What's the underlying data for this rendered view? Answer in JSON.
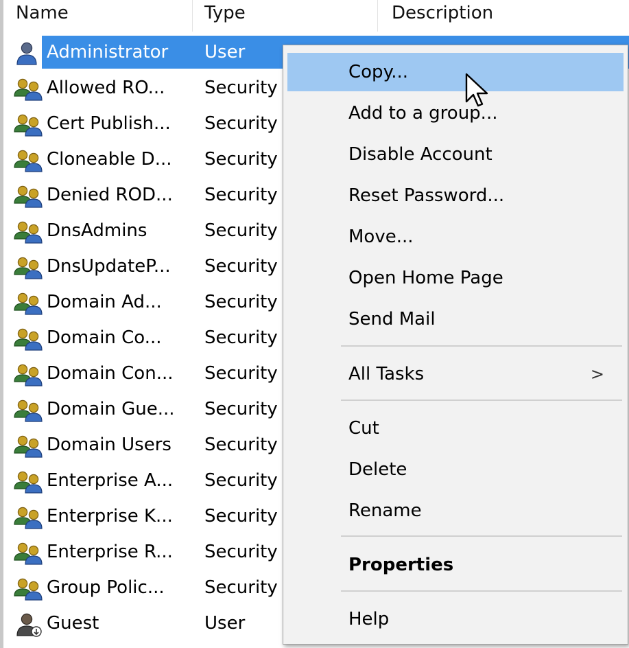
{
  "columns": {
    "name": "Name",
    "type": "Type",
    "description": "Description"
  },
  "rows": [
    {
      "name": "Administrator",
      "type": "User",
      "icon": "user-icon"
    },
    {
      "name": "Allowed RO...",
      "type": "Security",
      "icon": "group-icon"
    },
    {
      "name": "Cert Publish...",
      "type": "Security",
      "icon": "group-icon"
    },
    {
      "name": "Cloneable D...",
      "type": "Security",
      "icon": "group-icon"
    },
    {
      "name": "Denied ROD...",
      "type": "Security",
      "icon": "group-icon"
    },
    {
      "name": "DnsAdmins",
      "type": "Security",
      "icon": "group-icon"
    },
    {
      "name": "DnsUpdateP...",
      "type": "Security",
      "icon": "group-icon"
    },
    {
      "name": "Domain Ad...",
      "type": "Security",
      "icon": "group-icon"
    },
    {
      "name": "Domain Co...",
      "type": "Security",
      "icon": "group-icon"
    },
    {
      "name": "Domain Con...",
      "type": "Security",
      "icon": "group-icon"
    },
    {
      "name": "Domain Gue...",
      "type": "Security",
      "icon": "group-icon"
    },
    {
      "name": "Domain Users",
      "type": "Security",
      "icon": "group-icon"
    },
    {
      "name": "Enterprise A...",
      "type": "Security",
      "icon": "group-icon"
    },
    {
      "name": "Enterprise K...",
      "type": "Security",
      "icon": "group-icon"
    },
    {
      "name": "Enterprise R...",
      "type": "Security",
      "icon": "group-icon"
    },
    {
      "name": "Group Polic...",
      "type": "Security",
      "icon": "group-icon"
    },
    {
      "name": "Guest",
      "type": "User",
      "icon": "disabled-user-icon"
    }
  ],
  "context_menu": {
    "copy": "Copy...",
    "add_to_group": "Add to a group...",
    "disable_account": "Disable Account",
    "reset_password": "Reset Password...",
    "move": "Move...",
    "open_home_page": "Open Home Page",
    "send_mail": "Send Mail",
    "all_tasks": "All Tasks",
    "all_tasks_arrow": ">",
    "cut": "Cut",
    "delete": "Delete",
    "rename": "Rename",
    "properties": "Properties",
    "help": "Help"
  },
  "colors": {
    "selection": "#3a8ee6",
    "menu_hover": "#9ec8f2",
    "menu_bg": "#f2f2f2"
  }
}
